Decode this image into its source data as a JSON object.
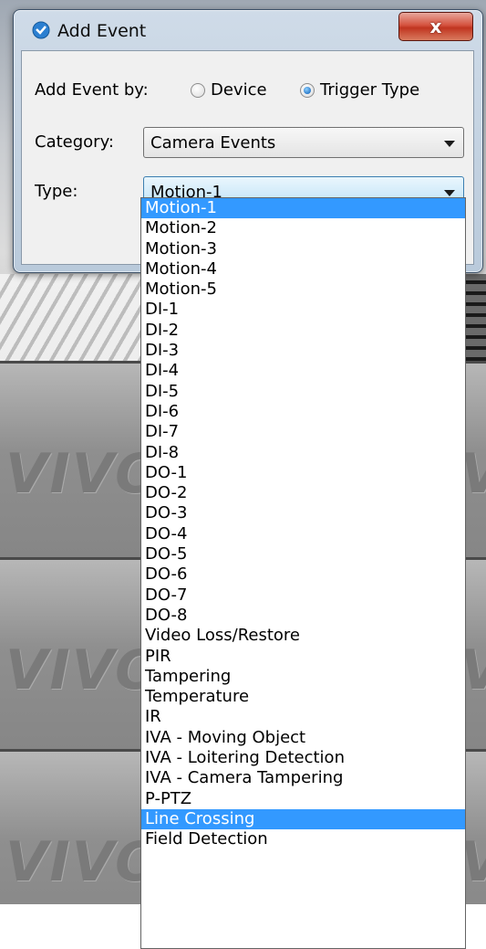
{
  "dialog": {
    "title": "Add Event",
    "close_glyph": "x",
    "add_event_by_label": "Add Event by:",
    "radio_device_label": "Device",
    "radio_trigger_label": "Trigger Type",
    "selected_mode": "Trigger Type",
    "category_label": "Category:",
    "category_value": "Camera Events",
    "type_label": "Type:",
    "type_value": "Motion-1"
  },
  "type_options": [
    "Motion-1",
    "Motion-2",
    "Motion-3",
    "Motion-4",
    "Motion-5",
    "DI-1",
    "DI-2",
    "DI-3",
    "DI-4",
    "DI-5",
    "DI-6",
    "DI-7",
    "DI-8",
    "DO-1",
    "DO-2",
    "DO-3",
    "DO-4",
    "DO-5",
    "DO-6",
    "DO-7",
    "DO-8",
    "Video Loss/Restore",
    "PIR",
    "Tampering",
    "Temperature",
    "IR",
    "IVA - Moving Object",
    "IVA - Loitering Detection",
    "IVA - Camera Tampering",
    "P-PTZ",
    "Line Crossing",
    "Field Detection"
  ],
  "highlighted_options": [
    "Motion-1",
    "Line Crossing"
  ],
  "background": {
    "watermark": "VIVO"
  },
  "colors": {
    "selection": "#3399ff",
    "close_button": "#c03520"
  }
}
